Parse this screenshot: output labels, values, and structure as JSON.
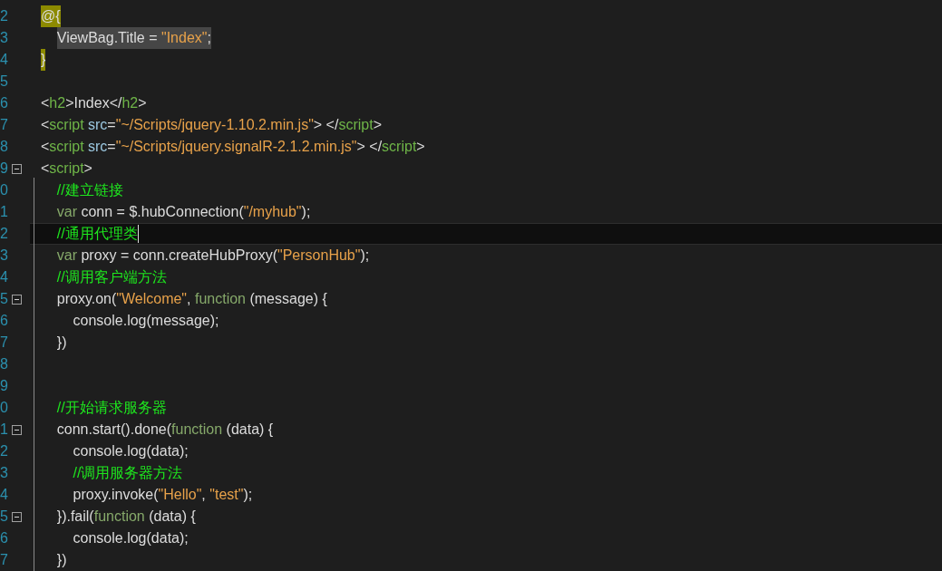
{
  "editor": {
    "lines": [
      {
        "number": "2",
        "current": false,
        "segments": [
          {
            "kind": "razor",
            "text": "@{"
          }
        ]
      },
      {
        "number": "3",
        "current": false,
        "highlighted": true,
        "segments": [
          {
            "kind": "plain",
            "text": "    ViewBag.Title = "
          },
          {
            "kind": "string",
            "text": "\"Index\""
          },
          {
            "kind": "plain",
            "text": ";"
          }
        ]
      },
      {
        "number": "4",
        "current": false,
        "segments": [
          {
            "kind": "razor",
            "text": "}"
          }
        ]
      },
      {
        "number": "5",
        "current": false
      },
      {
        "number": "6",
        "current": false,
        "segments": [
          {
            "kind": "plain",
            "text": "<"
          },
          {
            "kind": "tag",
            "text": "h2"
          },
          {
            "kind": "plain",
            "text": ">Index</"
          },
          {
            "kind": "tag",
            "text": "h2"
          },
          {
            "kind": "plain",
            "text": ">"
          }
        ]
      },
      {
        "number": "7",
        "current": false,
        "segments": [
          {
            "kind": "plain",
            "text": "<"
          },
          {
            "kind": "tag",
            "text": "script"
          },
          {
            "kind": "attr",
            "text": " src"
          },
          {
            "kind": "plain",
            "text": "="
          },
          {
            "kind": "string",
            "text": "\"~/Scripts/jquery-1.10.2.min.js\""
          },
          {
            "kind": "plain",
            "text": "> </"
          },
          {
            "kind": "tag",
            "text": "script"
          },
          {
            "kind": "plain",
            "text": ">"
          }
        ]
      },
      {
        "number": "8",
        "current": false,
        "segments": [
          {
            "kind": "plain",
            "text": "<"
          },
          {
            "kind": "tag",
            "text": "script"
          },
          {
            "kind": "attr",
            "text": " src"
          },
          {
            "kind": "plain",
            "text": "="
          },
          {
            "kind": "string",
            "text": "\"~/Scripts/jquery.signalR-2.1.2.min.js\""
          },
          {
            "kind": "plain",
            "text": "> </"
          },
          {
            "kind": "tag",
            "text": "script"
          },
          {
            "kind": "plain",
            "text": ">"
          }
        ]
      },
      {
        "number": "9",
        "current": false,
        "expanded": true,
        "segments": [
          {
            "kind": "plain",
            "text": "<"
          },
          {
            "kind": "tag",
            "text": "script"
          },
          {
            "kind": "plain",
            "text": ">"
          }
        ]
      },
      {
        "number": "0",
        "current": false,
        "segments": [
          {
            "kind": "comment",
            "text": "    //建立链接"
          }
        ]
      },
      {
        "number": "1",
        "current": false,
        "segments": [
          {
            "kind": "keyword",
            "text": "    var"
          },
          {
            "kind": "plain",
            "text": " conn = $.hubConnection("
          },
          {
            "kind": "string",
            "text": "\"/myhub\""
          },
          {
            "kind": "plain",
            "text": ");"
          }
        ]
      },
      {
        "number": "2",
        "current": true,
        "segments": [
          {
            "kind": "comment",
            "text": "    //通用代理类"
          }
        ]
      },
      {
        "number": "3",
        "current": false,
        "segments": [
          {
            "kind": "keyword",
            "text": "    var"
          },
          {
            "kind": "plain",
            "text": " proxy = conn.createHubProxy("
          },
          {
            "kind": "string",
            "text": "\"PersonHub\""
          },
          {
            "kind": "plain",
            "text": ");"
          }
        ]
      },
      {
        "number": "4",
        "current": false,
        "segments": [
          {
            "kind": "comment",
            "text": "    //调用客户端方法"
          }
        ]
      },
      {
        "number": "5",
        "current": false,
        "expanded": true,
        "segments": [
          {
            "kind": "plain",
            "text": "    proxy.on("
          },
          {
            "kind": "string",
            "text": "\"Welcome\""
          },
          {
            "kind": "plain",
            "text": ", "
          },
          {
            "kind": "keyword",
            "text": "function"
          },
          {
            "kind": "plain",
            "text": " (message) {"
          }
        ]
      },
      {
        "number": "6",
        "current": false,
        "segments": [
          {
            "kind": "plain",
            "text": "        console.log(message);"
          }
        ]
      },
      {
        "number": "7",
        "current": false,
        "segments": [
          {
            "kind": "plain",
            "text": "    })"
          }
        ]
      },
      {
        "number": "8",
        "current": false
      },
      {
        "number": "9",
        "current": false
      },
      {
        "number": "0",
        "current": false,
        "segments": [
          {
            "kind": "comment",
            "text": "    //开始请求服务器"
          }
        ]
      },
      {
        "number": "1",
        "current": false,
        "expanded": true,
        "segments": [
          {
            "kind": "plain",
            "text": "    conn.start().done("
          },
          {
            "kind": "keyword",
            "text": "function"
          },
          {
            "kind": "plain",
            "text": " (data) {"
          }
        ]
      },
      {
        "number": "2",
        "current": false,
        "segments": [
          {
            "kind": "plain",
            "text": "        console.log(data);"
          }
        ]
      },
      {
        "number": "3",
        "current": false,
        "segments": [
          {
            "kind": "comment",
            "text": "        //调用服务器方法"
          }
        ]
      },
      {
        "number": "4",
        "current": false,
        "segments": [
          {
            "kind": "plain",
            "text": "        proxy.invoke("
          },
          {
            "kind": "string",
            "text": "\"Hello\""
          },
          {
            "kind": "plain",
            "text": ", "
          },
          {
            "kind": "string",
            "text": "\"test\""
          },
          {
            "kind": "plain",
            "text": ");"
          }
        ]
      },
      {
        "number": "5",
        "current": false,
        "expanded": true,
        "segments": [
          {
            "kind": "plain",
            "text": "    }).fail("
          },
          {
            "kind": "keyword",
            "text": "function"
          },
          {
            "kind": "plain",
            "text": " (data) {"
          }
        ]
      },
      {
        "number": "6",
        "current": false,
        "segments": [
          {
            "kind": "plain",
            "text": "        console.log(data);"
          }
        ]
      },
      {
        "number": "7",
        "current": false,
        "segments": [
          {
            "kind": "plain",
            "text": "    })"
          }
        ]
      }
    ]
  }
}
